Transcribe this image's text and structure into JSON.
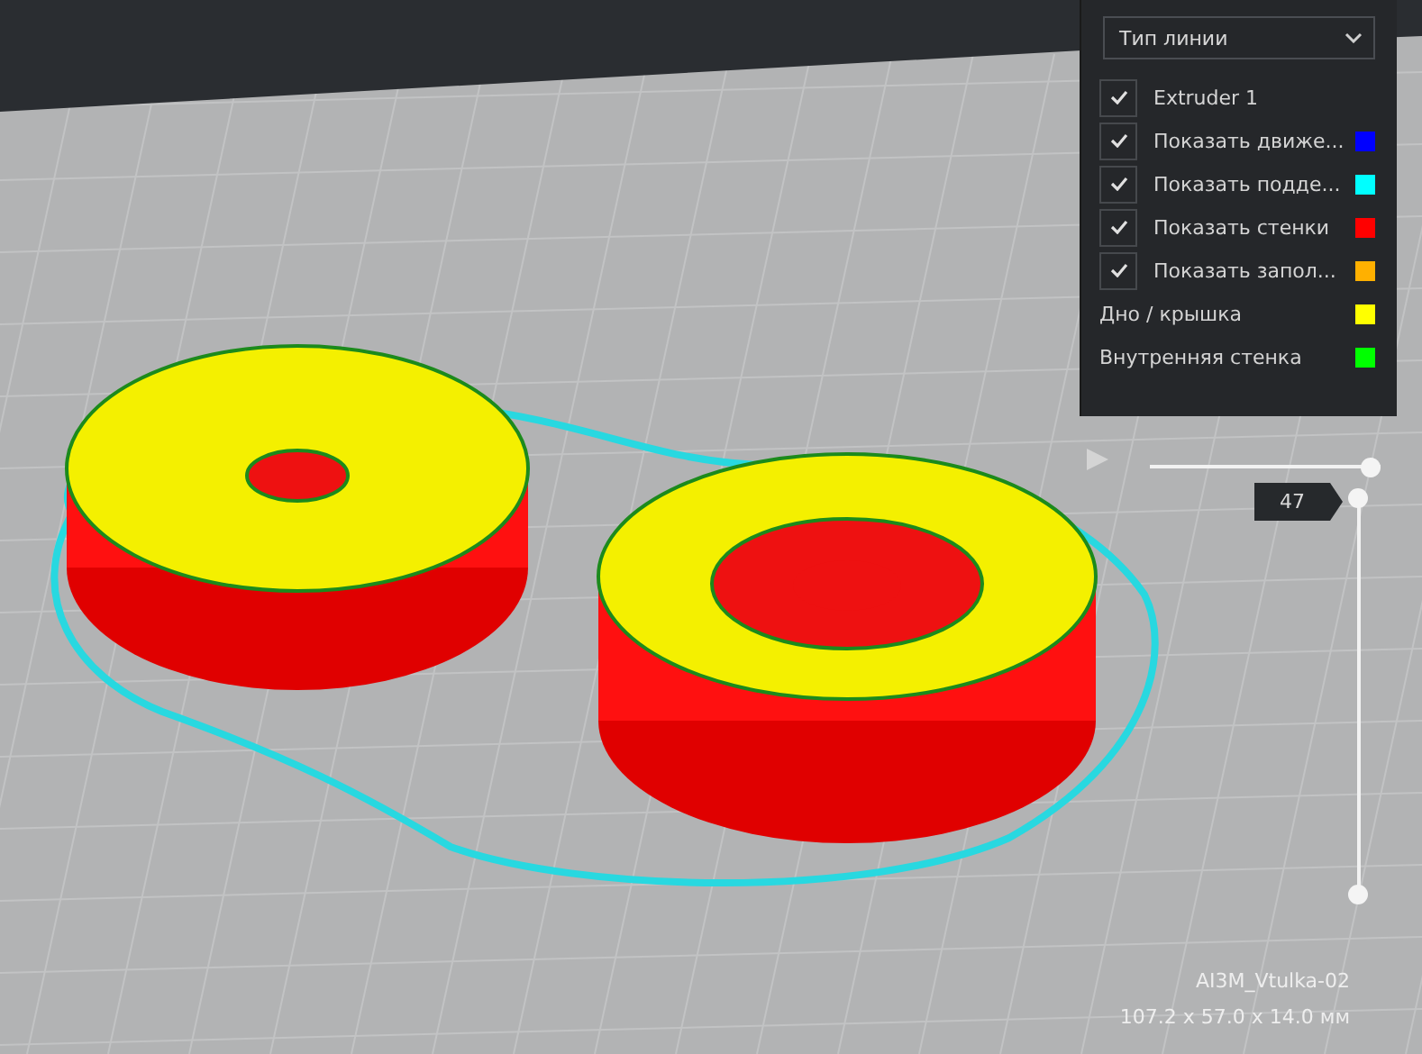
{
  "color_scheme": {
    "value": "Тип линии"
  },
  "legend": [
    {
      "kind": "checkbox",
      "label": "Extruder 1",
      "checked": true
    },
    {
      "kind": "checkbox",
      "label": "Показать движе...",
      "checked": true,
      "color": "#0000ff"
    },
    {
      "kind": "checkbox",
      "label": "Показать подде...",
      "checked": true,
      "color": "#00ffff"
    },
    {
      "kind": "checkbox",
      "label": "Показать стенки",
      "checked": true,
      "color": "#ff0000"
    },
    {
      "kind": "checkbox",
      "label": "Показать запол...",
      "checked": true,
      "color": "#ffb000"
    },
    {
      "kind": "swatch",
      "label": "Дно / крышка",
      "color": "#ffff00"
    },
    {
      "kind": "swatch",
      "label": "Внутренняя стенка",
      "color": "#00ff00"
    }
  ],
  "layer_slider": {
    "level": 1
  },
  "layer_range": {
    "label": "47",
    "handles": [
      {
        "level": 1
      },
      {
        "level": 0
      }
    ]
  },
  "model": {
    "name": "AI3M_Vtulka-02",
    "dimensions": "107.2 x 57.0 x 14.0 мм"
  }
}
